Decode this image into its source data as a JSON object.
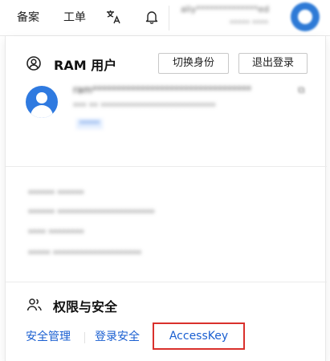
{
  "topbar": {
    "items": [
      {
        "label": "备案"
      },
      {
        "label": "工单"
      }
    ],
    "translate_icon": "translate-icon",
    "bell_icon": "bell-icon",
    "account_name": "aliy**************ed",
    "account_sub": "***** ****",
    "avatar_icon": "user-avatar-icon"
  },
  "ram_section": {
    "icon": "user-circle-icon",
    "title": "RAM 用户",
    "switch_button": "切换身份",
    "logout_button": "退出登录",
    "user": {
      "avatar_icon": "user-avatar-icon",
      "name": "ram*********************************",
      "sub": "*** ** **************************",
      "tag": "*****",
      "copy_icon": "copy-icon"
    },
    "info_rows": [
      {
        "text": "******  ******"
      },
      {
        "text": "******  **********************"
      },
      {
        "text": "****     ********"
      },
      {
        "text": "*****     ********************"
      }
    ]
  },
  "security_section": {
    "icon": "users-icon",
    "title": "权限与安全",
    "links": [
      {
        "label": "安全管理"
      },
      {
        "label": "登录安全"
      },
      {
        "label": "AccessKey"
      }
    ],
    "highlight_color": "#d9302c",
    "link_color": "#1a5fd1"
  }
}
